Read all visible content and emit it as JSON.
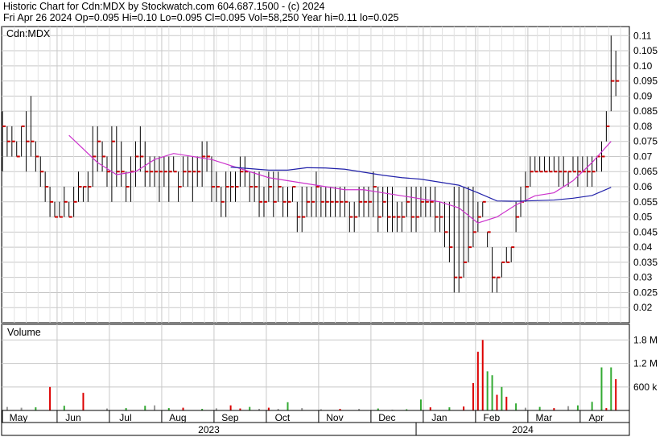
{
  "header": {
    "line1": "Historic Chart for Cdn:MDX by Stockwatch.com 604.687.1500 - (c) 2024",
    "line2": "Fri Apr 26 2024   Op=0.095  Hi=0.10  Lo=0.095  Cl=0.095  Vol=58,250  Year hi=0.11  lo=0.025"
  },
  "colors": {
    "background": "#ffffff",
    "grid": "#c8c8c8",
    "price_bar": "#000000",
    "close_tick": "#cc0000",
    "ma_short": "#cc33cc",
    "ma_long": "#2222aa",
    "vol_up": "#33aa33",
    "vol_down": "#dd0000",
    "vol_flat": "#999999"
  },
  "chart_data": [
    {
      "type": "ohlc",
      "title": "Cdn:MDX",
      "ylim": [
        0.015,
        0.113
      ],
      "y_ticks": [
        "0.11",
        "0.105",
        "0.10",
        "0.095",
        "0.09",
        "0.085",
        "0.08",
        "0.075",
        "0.07",
        "0.065",
        "0.06",
        "0.055",
        "0.05",
        "0.045",
        "0.04",
        "0.035",
        "0.03",
        "0.025",
        "0.02"
      ],
      "x_months": [
        "May",
        "Jun",
        "Jul",
        "Aug",
        "Sep",
        "Oct",
        "Nov",
        "Dec",
        "Jan",
        "Feb",
        "Mar",
        "Apr"
      ],
      "x_years": [
        "2023",
        "2024"
      ],
      "series": [
        {
          "kind": "price",
          "x": [
            0,
            2,
            4,
            6,
            8,
            10,
            12,
            14,
            16,
            18,
            20,
            22,
            24,
            26,
            28,
            30,
            32,
            34,
            36,
            38,
            40,
            42,
            44,
            46,
            48,
            50,
            52,
            54,
            56,
            58,
            60,
            62,
            64,
            66,
            68,
            70,
            72,
            74,
            76,
            78,
            80,
            82,
            84,
            86,
            88,
            90,
            92,
            94,
            96,
            98,
            100,
            102,
            104,
            106,
            108,
            110,
            112,
            114,
            116,
            118,
            120,
            122,
            124,
            126,
            128,
            130,
            132,
            134,
            136,
            138,
            140,
            142,
            144,
            146,
            148,
            150,
            152,
            154,
            156,
            158,
            160,
            162,
            164,
            166,
            168,
            170,
            172,
            174,
            176,
            178,
            180,
            182,
            184,
            186,
            188,
            190,
            192,
            194,
            196,
            198,
            200,
            202,
            204,
            206,
            208,
            210,
            212,
            214,
            216,
            218,
            220,
            222,
            224,
            226,
            228,
            230,
            232,
            234,
            236,
            238,
            240,
            242,
            244,
            246,
            248,
            250,
            252,
            254,
            256,
            258
          ],
          "high": [
            0.085,
            0.08,
            0.08,
            0.075,
            0.08,
            0.085,
            0.09,
            0.075,
            0.07,
            0.065,
            0.06,
            0.055,
            0.055,
            0.06,
            0.055,
            0.06,
            0.065,
            0.06,
            0.065,
            0.08,
            0.08,
            0.075,
            0.07,
            0.08,
            0.08,
            0.075,
            0.065,
            0.07,
            0.075,
            0.08,
            0.075,
            0.07,
            0.07,
            0.07,
            0.07,
            0.07,
            0.07,
            0.065,
            0.07,
            0.07,
            0.07,
            0.07,
            0.075,
            0.075,
            0.07,
            0.065,
            0.06,
            0.065,
            0.065,
            0.065,
            0.07,
            0.07,
            0.065,
            0.065,
            0.065,
            0.06,
            0.065,
            0.065,
            0.065,
            0.06,
            0.06,
            0.06,
            0.055,
            0.06,
            0.06,
            0.06,
            0.065,
            0.06,
            0.06,
            0.06,
            0.06,
            0.06,
            0.06,
            0.055,
            0.055,
            0.06,
            0.06,
            0.06,
            0.065,
            0.06,
            0.06,
            0.06,
            0.06,
            0.055,
            0.055,
            0.06,
            0.06,
            0.06,
            0.06,
            0.06,
            0.06,
            0.06,
            0.055,
            0.055,
            0.055,
            0.06,
            0.06,
            0.06,
            0.06,
            0.06,
            0.055,
            0.055,
            0.045,
            0.04,
            0.03,
            0.035,
            0.04,
            0.04,
            0.055,
            0.06,
            0.065,
            0.07,
            0.07,
            0.07,
            0.07,
            0.07,
            0.07,
            0.07,
            0.07,
            0.065,
            0.07,
            0.07,
            0.07,
            0.07,
            0.07,
            0.07,
            0.075,
            0.085,
            0.11,
            0.105
          ],
          "low": [
            0.065,
            0.07,
            0.07,
            0.07,
            0.07,
            0.065,
            0.07,
            0.065,
            0.06,
            0.055,
            0.05,
            0.05,
            0.05,
            0.05,
            0.05,
            0.05,
            0.055,
            0.055,
            0.055,
            0.06,
            0.065,
            0.065,
            0.06,
            0.055,
            0.06,
            0.06,
            0.055,
            0.055,
            0.06,
            0.065,
            0.06,
            0.06,
            0.06,
            0.055,
            0.06,
            0.055,
            0.065,
            0.055,
            0.06,
            0.06,
            0.055,
            0.06,
            0.06,
            0.065,
            0.055,
            0.055,
            0.05,
            0.05,
            0.055,
            0.055,
            0.06,
            0.06,
            0.055,
            0.055,
            0.05,
            0.05,
            0.055,
            0.05,
            0.055,
            0.05,
            0.05,
            0.055,
            0.045,
            0.045,
            0.05,
            0.05,
            0.05,
            0.05,
            0.05,
            0.05,
            0.05,
            0.05,
            0.05,
            0.045,
            0.045,
            0.05,
            0.05,
            0.05,
            0.05,
            0.045,
            0.05,
            0.045,
            0.045,
            0.045,
            0.045,
            0.05,
            0.045,
            0.045,
            0.05,
            0.05,
            0.05,
            0.045,
            0.045,
            0.04,
            0.035,
            0.025,
            0.025,
            0.03,
            0.035,
            0.04,
            0.045,
            0.05,
            0.04,
            0.025,
            0.025,
            0.03,
            0.035,
            0.035,
            0.045,
            0.05,
            0.055,
            0.06,
            0.065,
            0.065,
            0.065,
            0.065,
            0.065,
            0.06,
            0.06,
            0.06,
            0.065,
            0.06,
            0.065,
            0.06,
            0.06,
            0.065,
            0.065,
            0.075,
            0.085,
            0.09
          ],
          "close": [
            0.08,
            0.075,
            0.075,
            0.07,
            0.08,
            0.075,
            0.075,
            0.07,
            0.065,
            0.06,
            0.055,
            0.05,
            0.05,
            0.055,
            0.05,
            0.055,
            0.06,
            0.06,
            0.06,
            0.07,
            0.075,
            0.07,
            0.065,
            0.075,
            0.065,
            0.065,
            0.06,
            0.065,
            0.07,
            0.07,
            0.065,
            0.065,
            0.065,
            0.065,
            0.065,
            0.065,
            0.065,
            0.06,
            0.065,
            0.065,
            0.065,
            0.065,
            0.07,
            0.07,
            0.06,
            0.06,
            0.055,
            0.06,
            0.06,
            0.06,
            0.065,
            0.065,
            0.06,
            0.06,
            0.055,
            0.055,
            0.06,
            0.055,
            0.06,
            0.055,
            0.055,
            0.06,
            0.05,
            0.05,
            0.055,
            0.055,
            0.06,
            0.055,
            0.055,
            0.055,
            0.055,
            0.055,
            0.055,
            0.05,
            0.05,
            0.055,
            0.055,
            0.055,
            0.06,
            0.05,
            0.055,
            0.05,
            0.05,
            0.05,
            0.05,
            0.055,
            0.05,
            0.05,
            0.055,
            0.055,
            0.055,
            0.05,
            0.05,
            0.045,
            0.04,
            0.03,
            0.03,
            0.035,
            0.04,
            0.045,
            0.05,
            0.055,
            0.045,
            0.03,
            0.03,
            0.035,
            0.035,
            0.04,
            0.05,
            0.055,
            0.06,
            0.065,
            0.065,
            0.065,
            0.065,
            0.065,
            0.065,
            0.065,
            0.065,
            0.065,
            0.065,
            0.065,
            0.065,
            0.065,
            0.065,
            0.07,
            0.07,
            0.08,
            0.095,
            0.095
          ]
        },
        {
          "kind": "ma_short",
          "x": [
            28,
            32,
            40,
            48,
            56,
            64,
            72,
            80,
            88,
            96,
            104,
            112,
            120,
            128,
            136,
            144,
            152,
            160,
            168,
            176,
            184,
            192,
            200,
            208,
            216,
            224,
            232,
            240,
            248,
            256
          ],
          "values": [
            0.077,
            0.074,
            0.068,
            0.064,
            0.065,
            0.069,
            0.071,
            0.07,
            0.069,
            0.067,
            0.065,
            0.063,
            0.062,
            0.061,
            0.06,
            0.059,
            0.059,
            0.058,
            0.057,
            0.056,
            0.055,
            0.053,
            0.048,
            0.05,
            0.054,
            0.057,
            0.058,
            0.062,
            0.068,
            0.075
          ]
        },
        {
          "kind": "ma_long",
          "x": [
            96,
            104,
            112,
            120,
            128,
            136,
            144,
            152,
            160,
            168,
            176,
            184,
            192,
            200,
            208,
            216,
            224,
            232,
            240,
            248,
            256
          ],
          "values": [
            0.0665,
            0.066,
            0.0655,
            0.0655,
            0.0663,
            0.0662,
            0.0658,
            0.0648,
            0.0638,
            0.063,
            0.0625,
            0.0615,
            0.0605,
            0.058,
            0.0553,
            0.0552,
            0.0554,
            0.0556,
            0.0562,
            0.0571,
            0.0598
          ]
        }
      ]
    },
    {
      "type": "bar",
      "title": "Volume",
      "ylim": [
        0,
        2200000
      ],
      "y_ticks": [
        "1.8 M",
        "1.2 M",
        "600 k"
      ],
      "x": [
        2,
        8,
        14,
        20,
        26,
        34,
        44,
        52,
        60,
        64,
        70,
        76,
        84,
        90,
        96,
        100,
        104,
        108,
        112,
        116,
        120,
        126,
        134,
        142,
        150,
        158,
        164,
        170,
        176,
        180,
        188,
        194,
        198,
        200,
        202,
        204,
        206,
        208,
        210,
        212,
        216,
        220,
        226,
        232,
        238,
        242,
        248,
        252,
        254,
        256,
        258
      ],
      "values": [
        90000,
        70000,
        80000,
        600000,
        120000,
        450000,
        50000,
        60000,
        120000,
        130000,
        60000,
        70000,
        40000,
        55000,
        130000,
        50000,
        90000,
        40000,
        70000,
        40000,
        210000,
        60000,
        30000,
        40000,
        40000,
        50000,
        20000,
        30000,
        280000,
        80000,
        80000,
        100000,
        700000,
        1500000,
        1800000,
        1000000,
        900000,
        400000,
        600000,
        350000,
        180000,
        70000,
        90000,
        60000,
        110000,
        130000,
        220000,
        1100000,
        60000,
        1100000,
        800000
      ],
      "colors": [
        "flat",
        "flat",
        "up",
        "down",
        "up",
        "down",
        "flat",
        "up",
        "up",
        "flat",
        "up",
        "down",
        "up",
        "flat",
        "down",
        "down",
        "up",
        "flat",
        "down",
        "flat",
        "up",
        "flat",
        "flat",
        "down",
        "flat",
        "up",
        "flat",
        "up",
        "up",
        "down",
        "up",
        "down",
        "down",
        "down",
        "down",
        "up",
        "up",
        "down",
        "up",
        "down",
        "up",
        "flat",
        "up",
        "down",
        "flat",
        "up",
        "up",
        "up",
        "down",
        "up",
        "down"
      ]
    }
  ]
}
